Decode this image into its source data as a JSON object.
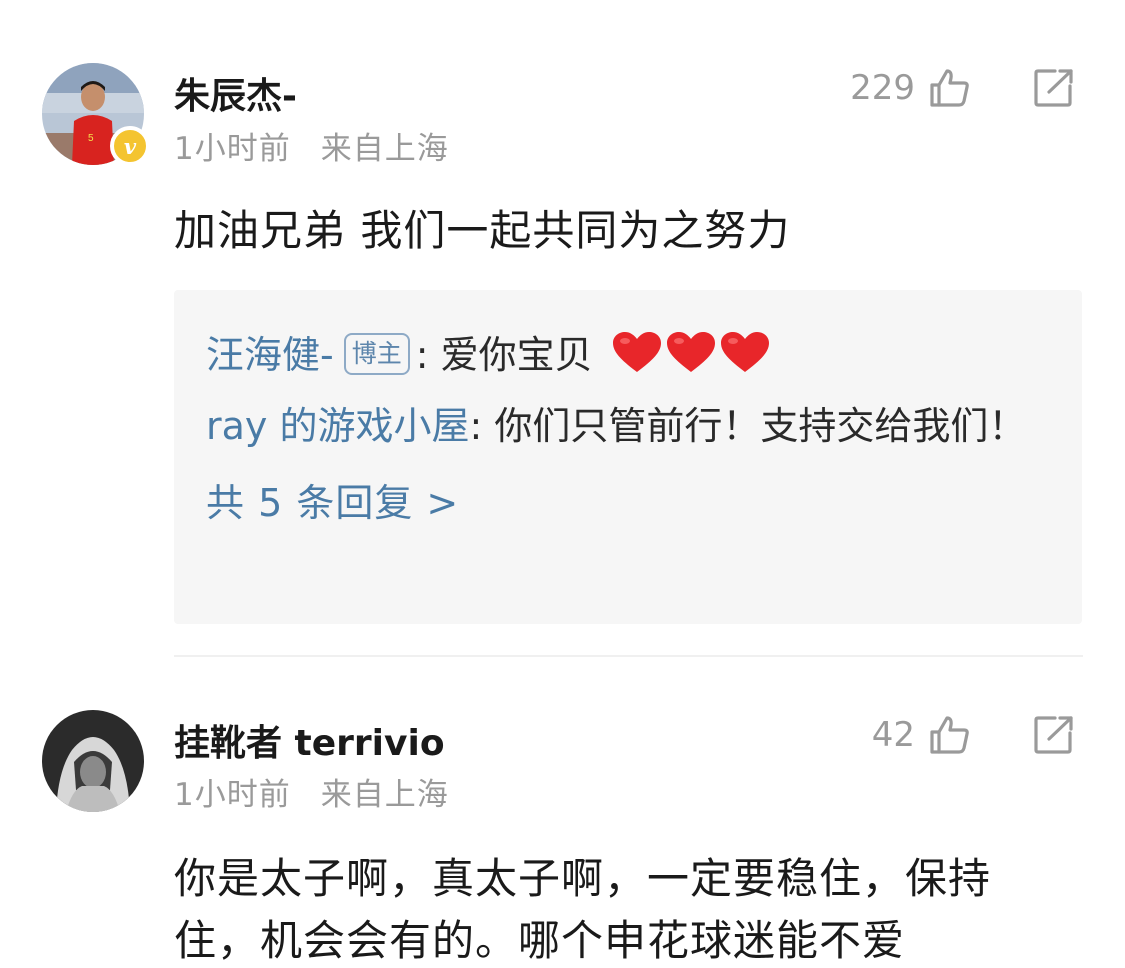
{
  "comments": [
    {
      "username": "朱辰杰-",
      "time": "1小时前",
      "location": "来自上海",
      "likes": "229",
      "verified": true,
      "verified_badge": "v",
      "text": "加油兄弟 我们一起共同为之努力",
      "replies": [
        {
          "author": "汪海健-",
          "badge": "博主",
          "text": "爱你宝贝",
          "hearts": 3
        },
        {
          "author": "ray 的游戏小屋",
          "text": "你们只管前行！支持交给我们！"
        }
      ],
      "more_replies": "共 5 条回复 >"
    },
    {
      "username": "挂靴者 terrivio",
      "time": "1小时前",
      "location": "来自上海",
      "likes": "42",
      "text": "你是太子啊，真太子啊，一定要稳住，保持住，机会会有的。哪个申花球迷能不爱"
    }
  ],
  "colors": {
    "link_blue": "#4a7ba6",
    "gray_text": "#9a9a9a",
    "verified_gold": "#f4c430",
    "heart_red": "#e8262a",
    "reply_bg": "#f6f6f6"
  },
  "icons": {
    "like": "thumbs-up-icon",
    "share": "share-icon",
    "heart": "heart-icon",
    "verified": "verified-badge-icon"
  }
}
